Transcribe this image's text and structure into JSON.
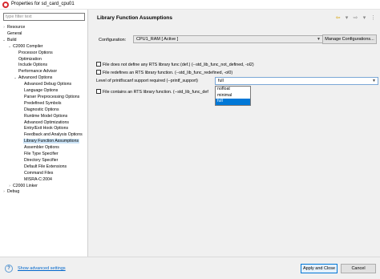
{
  "window": {
    "title": "Properties for sd_card_cpu01",
    "icon": "ccs-app-icon"
  },
  "sidebar": {
    "filter_placeholder": "type filter text",
    "tree": [
      {
        "label": "Resource",
        "depth": 0,
        "expander": "collapsed"
      },
      {
        "label": "General",
        "depth": 0,
        "expander": "none"
      },
      {
        "label": "Build",
        "depth": 0,
        "expander": "expanded"
      },
      {
        "label": "C2000 Compiler",
        "depth": 1,
        "expander": "expanded"
      },
      {
        "label": "Processor Options",
        "depth": 2,
        "expander": "none"
      },
      {
        "label": "Optimization",
        "depth": 2,
        "expander": "none"
      },
      {
        "label": "Include Options",
        "depth": 2,
        "expander": "none"
      },
      {
        "label": "Performance Advisor",
        "depth": 2,
        "expander": "none"
      },
      {
        "label": "Advanced Options",
        "depth": 2,
        "expander": "expanded"
      },
      {
        "label": "Advanced Debug Options",
        "depth": 3,
        "expander": "none"
      },
      {
        "label": "Language Options",
        "depth": 3,
        "expander": "none"
      },
      {
        "label": "Parser Preprocessing Options",
        "depth": 3,
        "expander": "none"
      },
      {
        "label": "Predefined Symbols",
        "depth": 3,
        "expander": "none"
      },
      {
        "label": "Diagnostic Options",
        "depth": 3,
        "expander": "none"
      },
      {
        "label": "Runtime Model Options",
        "depth": 3,
        "expander": "none"
      },
      {
        "label": "Advanced Optimizations",
        "depth": 3,
        "expander": "none"
      },
      {
        "label": "Entry/Exit Hook Options",
        "depth": 3,
        "expander": "none"
      },
      {
        "label": "Feedback and Analysis Options",
        "depth": 3,
        "expander": "none"
      },
      {
        "label": "Library Function Assumptions",
        "depth": 3,
        "expander": "none",
        "selected": true
      },
      {
        "label": "Assembler Options",
        "depth": 3,
        "expander": "none"
      },
      {
        "label": "File Type Specifier",
        "depth": 3,
        "expander": "none"
      },
      {
        "label": "Directory Specifier",
        "depth": 3,
        "expander": "none"
      },
      {
        "label": "Default File Extensions",
        "depth": 3,
        "expander": "none"
      },
      {
        "label": "Command Files",
        "depth": 3,
        "expander": "none"
      },
      {
        "label": "MISRA-C:2004",
        "depth": 3,
        "expander": "none"
      },
      {
        "label": "C2000 Linker",
        "depth": 1,
        "expander": "collapsed"
      },
      {
        "label": "Debug",
        "depth": 0,
        "expander": "collapsed"
      }
    ]
  },
  "main": {
    "title": "Library Function Assumptions",
    "nav_icons": [
      "back-arrow-icon",
      "dropdown-arrow-icon",
      "forward-arrow-icon",
      "dropdown-arrow-icon",
      "menu-icon"
    ],
    "configuration": {
      "label": "Configuration:",
      "value": "CPU1_RAM  [ Active ]",
      "manage_label": "Manage Configurations..."
    },
    "options": [
      {
        "label": "File does not define any RTS library func (def.) (--std_lib_func_not_defined, -ol2)",
        "checked": false
      },
      {
        "label": "File redefines an RTS library function. (--std_lib_func_redefined, -ol0)",
        "checked": false
      }
    ],
    "printf_level": {
      "label": "Level of printf/scanf support required (--printf_support)",
      "value": "full",
      "options": [
        "nofloat",
        "minimal",
        "full"
      ],
      "selected_index": 2
    },
    "defined_option": {
      "label": "File contains an RTS library function. (--std_lib_func_def",
      "checked": false
    }
  },
  "footer": {
    "help_icon": "help-icon",
    "help_glyph": "?",
    "advanced_link": "Show advanced settings",
    "apply_label": "Apply and Close",
    "cancel_label": "Cancel"
  }
}
